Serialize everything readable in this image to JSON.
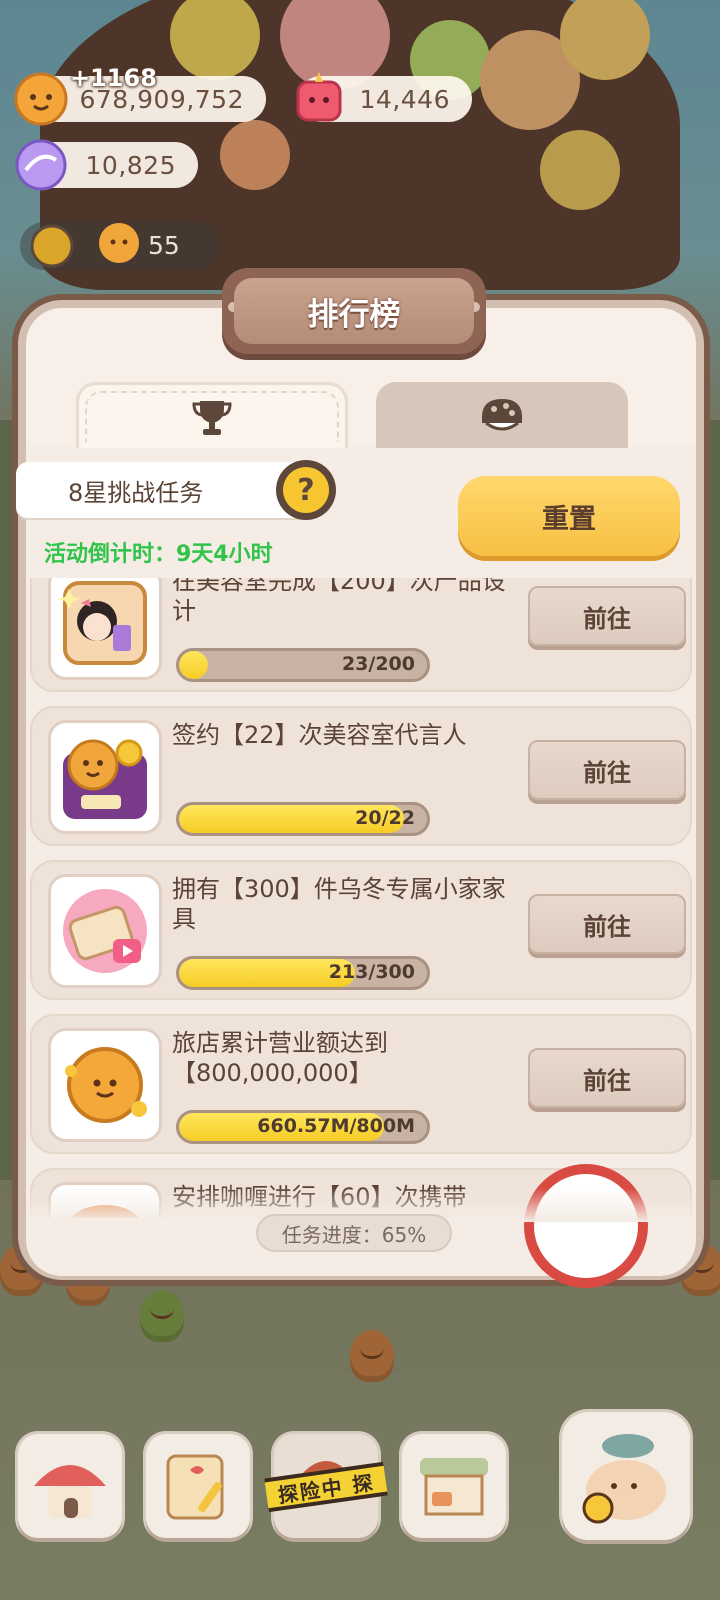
{
  "currency": {
    "coins": "678,909,752",
    "coins_gain": "+1168",
    "gems": "14,446",
    "crystals": "10,825",
    "level": "55"
  },
  "panel": {
    "title": "排行榜",
    "tabs": [
      {
        "icon": "trophy-icon",
        "active": true
      },
      {
        "icon": "cookie-icon",
        "active": false
      }
    ],
    "challenge_label": "8星挑战任务",
    "help_label": "?",
    "reset_label": "重置",
    "countdown": "活动倒计时：9天4小时",
    "tasks": [
      {
        "desc": "在美容室完成【200】次产品设计",
        "progress_text": "23/200",
        "progress": 0.115,
        "button": "前往"
      },
      {
        "desc": "签约【22】次美容室代言人",
        "progress_text": "20/22",
        "progress": 0.909,
        "button": "前往"
      },
      {
        "desc": "拥有【300】件乌冬专属小家家具",
        "progress_text": "213/300",
        "progress": 0.71,
        "button": "前往"
      },
      {
        "desc": "旅店累计营业额达到【800,000,000】",
        "progress_text": "660.57M/800M",
        "progress": 0.826,
        "button": "前往"
      },
      {
        "desc": "安排咖喱进行【60】次携带"
      }
    ],
    "total_progress": "任务进度：65%"
  },
  "nav": {
    "items": [
      {
        "icon": "mushroom-house-icon"
      },
      {
        "icon": "notepad-icon"
      },
      {
        "icon": "adventure-icon",
        "label": "探险中 探"
      },
      {
        "icon": "shop-stall-icon"
      },
      {
        "icon": "fish-character-icon"
      }
    ]
  },
  "colors": {
    "accent_yellow": "#f7c043",
    "countdown_green": "#31c34a",
    "panel_bg": "#f7efe8",
    "frame_brown": "#7a5a48"
  }
}
